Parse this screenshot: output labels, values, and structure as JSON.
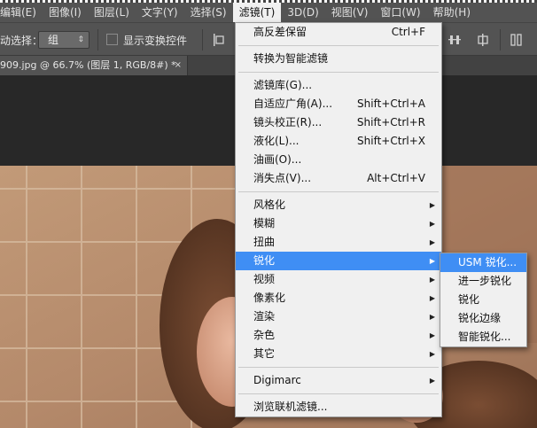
{
  "menubar": {
    "items": [
      {
        "label": "编辑(E)",
        "active": false
      },
      {
        "label": "图像(I)",
        "active": false
      },
      {
        "label": "图层(L)",
        "active": false
      },
      {
        "label": "文字(Y)",
        "active": false
      },
      {
        "label": "选择(S)",
        "active": false
      },
      {
        "label": "滤镜(T)",
        "active": true
      },
      {
        "label": "3D(D)",
        "active": false
      },
      {
        "label": "视图(V)",
        "active": false
      },
      {
        "label": "窗口(W)",
        "active": false
      },
      {
        "label": "帮助(H)",
        "active": false
      }
    ]
  },
  "options": {
    "auto_select_label": "动选择：",
    "group_select_value": "组",
    "show_transform_label": "显示变换控件"
  },
  "document_tab": {
    "title": "909.jpg @ 66.7% (图层 1, RGB/8#) *",
    "close_glyph": "×"
  },
  "filter_menu": {
    "items": [
      {
        "type": "item",
        "label": "高反差保留",
        "shortcut": "Ctrl+F"
      },
      {
        "type": "sep"
      },
      {
        "type": "item",
        "label": "转换为智能滤镜",
        "shortcut": ""
      },
      {
        "type": "sep"
      },
      {
        "type": "item",
        "label": "滤镜库(G)...",
        "shortcut": ""
      },
      {
        "type": "item",
        "label": "自适应广角(A)...",
        "shortcut": "Shift+Ctrl+A"
      },
      {
        "type": "item",
        "label": "镜头校正(R)...",
        "shortcut": "Shift+Ctrl+R"
      },
      {
        "type": "item",
        "label": "液化(L)...",
        "shortcut": "Shift+Ctrl+X"
      },
      {
        "type": "item",
        "label": "油画(O)...",
        "shortcut": ""
      },
      {
        "type": "item",
        "label": "消失点(V)...",
        "shortcut": "Alt+Ctrl+V"
      },
      {
        "type": "sep"
      },
      {
        "type": "item",
        "label": "风格化",
        "submenu": true
      },
      {
        "type": "item",
        "label": "模糊",
        "submenu": true
      },
      {
        "type": "item",
        "label": "扭曲",
        "submenu": true
      },
      {
        "type": "item",
        "label": "锐化",
        "submenu": true,
        "highlighted": true
      },
      {
        "type": "item",
        "label": "视频",
        "submenu": true
      },
      {
        "type": "item",
        "label": "像素化",
        "submenu": true
      },
      {
        "type": "item",
        "label": "渲染",
        "submenu": true
      },
      {
        "type": "item",
        "label": "杂色",
        "submenu": true
      },
      {
        "type": "item",
        "label": "其它",
        "submenu": true
      },
      {
        "type": "sep"
      },
      {
        "type": "item",
        "label": "Digimarc",
        "submenu": true
      },
      {
        "type": "sep"
      },
      {
        "type": "item",
        "label": "浏览联机滤镜...",
        "shortcut": ""
      }
    ]
  },
  "sharpen_submenu": {
    "items": [
      {
        "label": "USM 锐化...",
        "highlighted": true
      },
      {
        "label": "进一步锐化",
        "highlighted": false
      },
      {
        "label": "锐化",
        "highlighted": false
      },
      {
        "label": "锐化边缘",
        "highlighted": false
      },
      {
        "label": "智能锐化...",
        "highlighted": false
      }
    ]
  },
  "icons": {
    "submenu_arrow": "▶",
    "dropdown_arrow": "⇕"
  },
  "colors": {
    "menu_highlight": "#3f8ef4",
    "menubar_bg": "#535353",
    "menu_bg": "#f0f0f0"
  }
}
